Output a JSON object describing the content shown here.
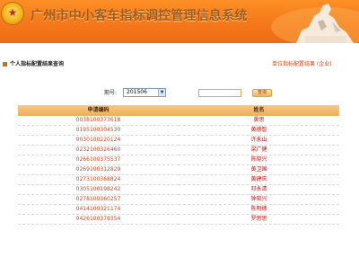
{
  "header": {
    "system_title": "广州市中小客车指标调控管理信息系统",
    "emblem_glyph": "★",
    "colors": {
      "banner": "#f5781a",
      "accent": "#c8461b",
      "table_header": "#f3b868"
    }
  },
  "section": {
    "title": "个人指标配置结果查询",
    "unit_link": "单位指标配置结果 (企业)",
    "bullet_icon": "square-bullet-icon"
  },
  "search": {
    "label": "期号:",
    "batch_value": "201506",
    "input_value": "",
    "query_button": "查询"
  },
  "table": {
    "columns": [
      "申请编码",
      "姓名"
    ],
    "rows": [
      {
        "code": "0038100373618",
        "name": "黄思"
      },
      {
        "code": "0195100304530",
        "name": "黄德智"
      },
      {
        "code": "0030100220124",
        "name": "许永山"
      },
      {
        "code": "0232100326460",
        "name": "梁广健"
      },
      {
        "code": "0266100375537",
        "name": "陈晓兴"
      },
      {
        "code": "0269100312829",
        "name": "黄卫国"
      },
      {
        "code": "0273100368824",
        "name": "黄建庆"
      },
      {
        "code": "0305100198242",
        "name": "邓永清"
      },
      {
        "code": "0278100360257",
        "name": "钟晓兴"
      },
      {
        "code": "0414100321174",
        "name": "陈明德"
      },
      {
        "code": "0426100378354",
        "name": "罗思思"
      }
    ]
  }
}
